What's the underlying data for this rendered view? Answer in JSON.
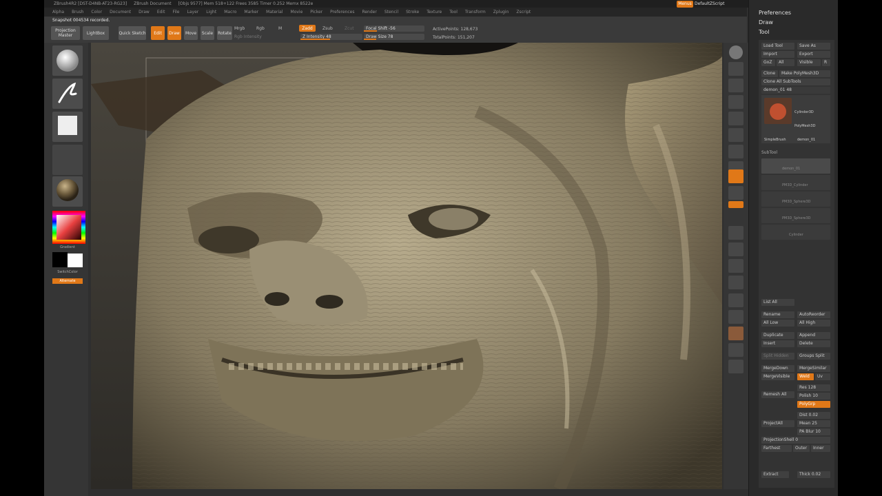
{
  "title_bar": {
    "items": [
      "ZBrush4R2 [DST-D4NB-AT23-RG23]",
      "ZBrush Document",
      "[Objs 9577] Mem 518+122 Frees 3585 Timer 0.252 Memx 8522e"
    ]
  },
  "menu_bar": {
    "items": [
      "Alpha",
      "Brush",
      "Color",
      "Document",
      "Draw",
      "Edit",
      "File",
      "Layer",
      "Light",
      "Macro",
      "Marker",
      "Material",
      "Movie",
      "Picker",
      "Preferences",
      "Render",
      "Stencil",
      "Stroke",
      "Texture",
      "Tool",
      "Transform",
      "Zplugin",
      "Zscript"
    ],
    "menus_button": "Menus",
    "script_label": "DefaultZScript"
  },
  "top_shelf": {
    "snapshot": "Snapshot 004534 recorded.",
    "projection_master": "Projection Master",
    "lightbox": "LightBox",
    "quick_sketch": "Quick Sketch",
    "edit": "Edit",
    "draw": "Draw",
    "move": "Move",
    "scale": "Scale",
    "rotate": "Rotate",
    "mrgb": "Mrgb",
    "rgb": "Rgb",
    "m": "M",
    "rgb_intensity": "Rgb Intensity",
    "zadd": "Zadd",
    "zsub": "Zsub",
    "zcut": "Zcut",
    "z_intensity": "Z Intensity 48",
    "focal_shift": "Focal Shift -56",
    "draw_size": "Draw Size 78",
    "active_points": "ActivePoints: 128,673",
    "total_points": "TotalPoints: 151,207",
    "z_intensity_level": 0.48,
    "focal_shift_level": 0.22,
    "draw_size_level": 0.2
  },
  "left_shelf": {
    "gradient": "Gradient",
    "switch_color": "SwitchColor",
    "alternate": "Alternate"
  },
  "right_shelf": {
    "icons": [
      "Bpr",
      "SPix",
      "Scroll",
      "Zoom",
      "Actual",
      "AAHalf",
      "Persp",
      "Floor",
      "Local",
      "L.Sym",
      "Gxyz",
      "Frame",
      "Move",
      "Scale",
      "Rotate",
      "PolyF",
      "Transp",
      "Ghost",
      "Solo",
      "Xpose"
    ]
  },
  "palette": {
    "preferences": "Preferences",
    "draw": "Draw",
    "tool": "Tool",
    "load_tool": "Load Tool",
    "save_as": "Save As",
    "import": "Import",
    "export": "Export",
    "goz": "GoZ",
    "all": "All",
    "visible": "Visible",
    "r": "R",
    "clone": "Clone",
    "make_polymesh": "Make PolyMesh3D",
    "clone_all": "Clone All SubTools",
    "demon_slider": "demon_01 48",
    "cylinder": "Cylinder3D",
    "polymesh": "PolyMesh3D",
    "simplebrush": "SimpleBrush",
    "demon": "demon_01",
    "subtool": "SubTool",
    "subtool_names": [
      "demon_01",
      "PM3D_Cylinder",
      "PM3D_Sphere3D",
      "PM3D_Sphere3D",
      "Cylinder"
    ],
    "list_all": "List All",
    "rename": "Rename",
    "auto_reorder": "AutoReorder",
    "all_low": "All Low",
    "all_high": "All High",
    "duplicate": "Duplicate",
    "append": "Append",
    "insert": "Insert",
    "delete": "Delete",
    "split_hidden": "Split Hidden",
    "groups_split": "Groups Split",
    "merge_down": "MergeDown",
    "merge_similar": "MergeSimilar",
    "merge_visible": "MergeVisible",
    "weld": "Weld",
    "uv": "Uv",
    "remesh_all": "Remesh All",
    "res": "Res 128",
    "polish": "Polish 10",
    "polygrp": "PolyGrp",
    "project_all": "ProjectAll",
    "dist": "Dist 0.02",
    "mean": "Mean 25",
    "pa_blur": "PA Blur 10",
    "projection_shell": "ProjectionShell 0",
    "farthest": "Farthest",
    "outer": "Outer",
    "inner": "Inner",
    "extract": "Extract",
    "thick": "Thick 0.02"
  }
}
